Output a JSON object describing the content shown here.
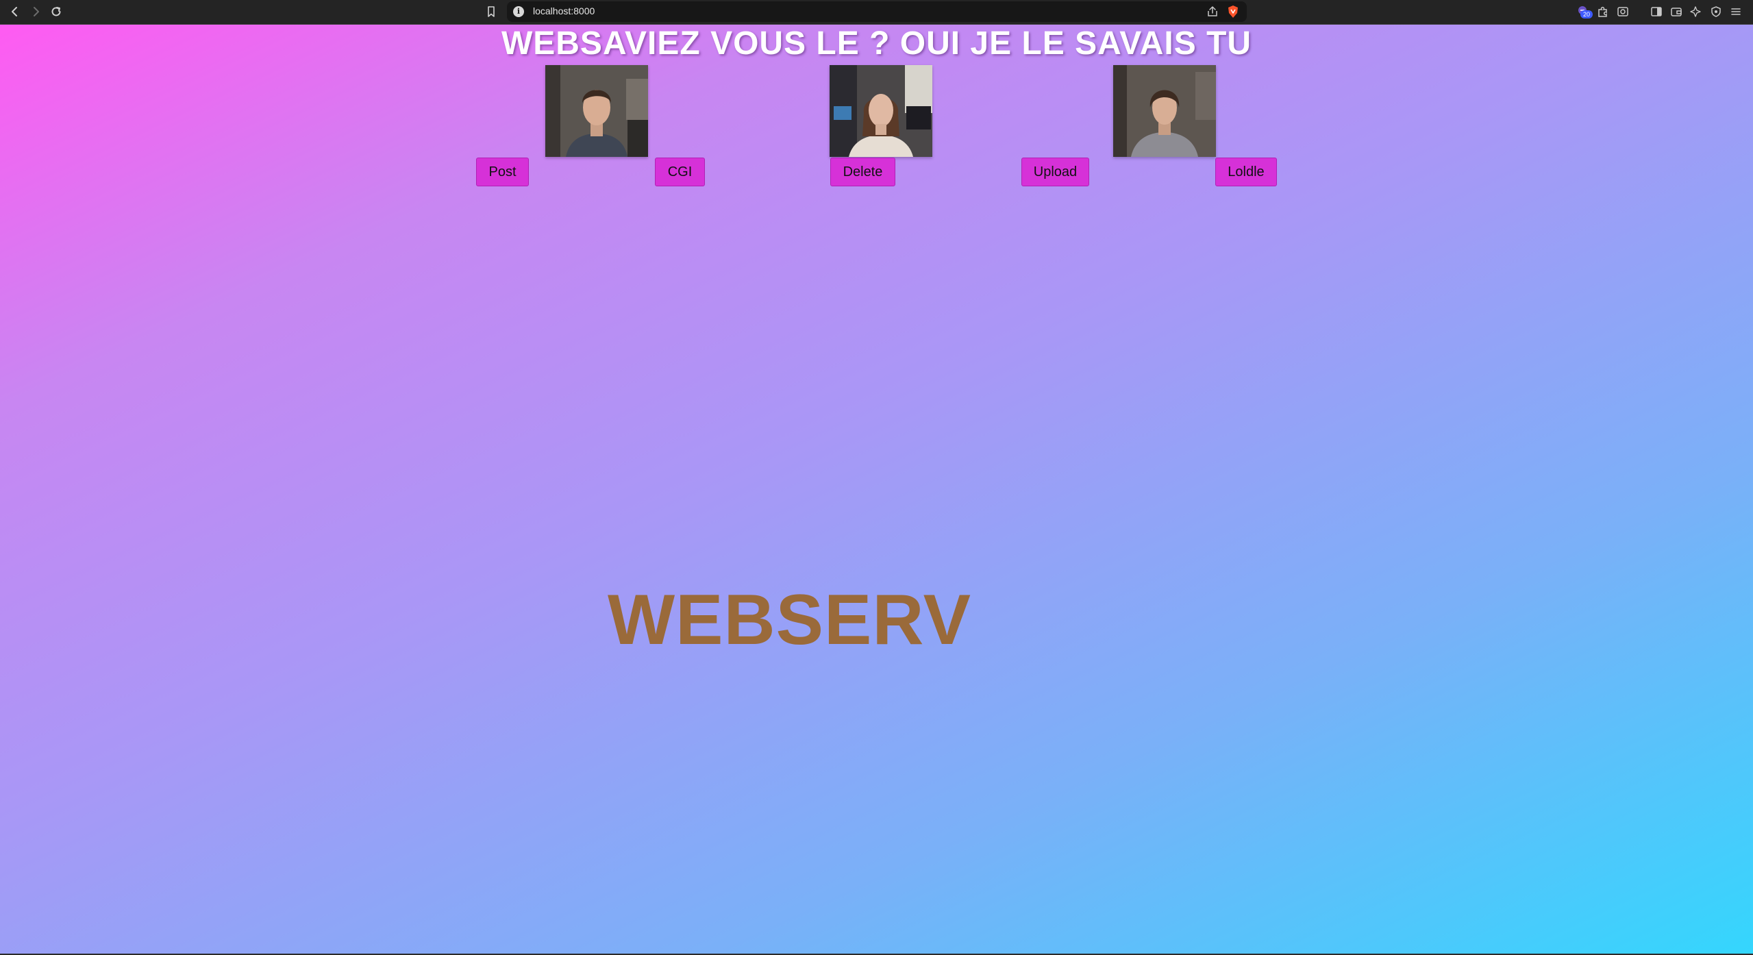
{
  "browser": {
    "url": "localhost:8000",
    "extension_badge": "20",
    "icons": [
      "back-arrow-icon",
      "forward-arrow-icon",
      "reload-icon",
      "bookmark-icon",
      "site-info-icon",
      "share-icon",
      "brave-shield-icon",
      "rewards-extension-icon",
      "puzzle-extension-icon",
      "screenshot-extension-icon",
      "sidebar-toggle-icon",
      "wallet-icon",
      "leo-ai-icon",
      "vpn-shield-icon",
      "menu-icon"
    ]
  },
  "page": {
    "heading": "WEBSAVIEZ VOUS LE ? OUI JE LE SAVAIS TU",
    "buttons": {
      "post": "Post",
      "cgi": "CGI",
      "delete": "Delete",
      "upload": "Upload",
      "loldle": "Loldle"
    },
    "title": "WEBSERV"
  },
  "colors": {
    "gradient_start": "#ff5bf2",
    "gradient_end": "#34d6fd",
    "button_bg": "#d631d8",
    "title_color": "#9a6a3a",
    "heading_color": "#ffffff"
  }
}
